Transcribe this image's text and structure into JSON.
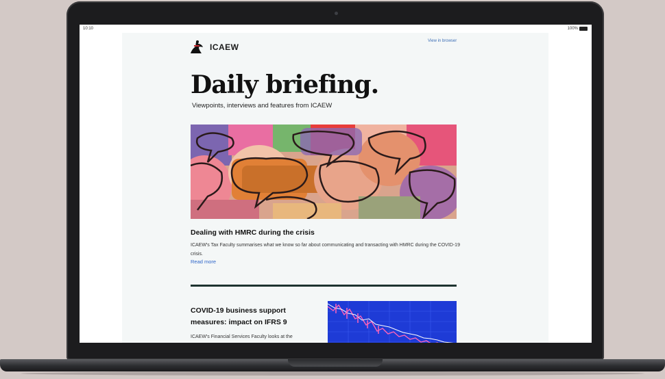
{
  "status_bar": {
    "time": "10:10",
    "battery": "100%"
  },
  "email": {
    "brand": "ICAEW",
    "view_in_browser": "View in browser",
    "headline": "Daily briefing.",
    "subheadline": "Viewpoints, interviews and features from ICAEW",
    "featured": {
      "title": "Dealing with HMRC during the crisis",
      "description": "ICAEW's Tax Faculty summarises what we know so far about communicating and transacting with HMRC during the COVID-19 crisis.",
      "link": "Read more"
    },
    "second": {
      "title": "COVID-19 business support measures: impact on IFRS 9",
      "description": "ICAEW's Financial Services Faculty looks at the"
    }
  },
  "colors": {
    "background": "#d3c9c6",
    "laptop_body": "#1c1c1e",
    "email_bg": "#f4f7f7",
    "link": "#2f66c9",
    "divider": "#1d3330",
    "chart_bg": "#1e3bd6"
  },
  "icons": [
    "camera-icon",
    "battery-icon",
    "icaew-logo-icon"
  ]
}
